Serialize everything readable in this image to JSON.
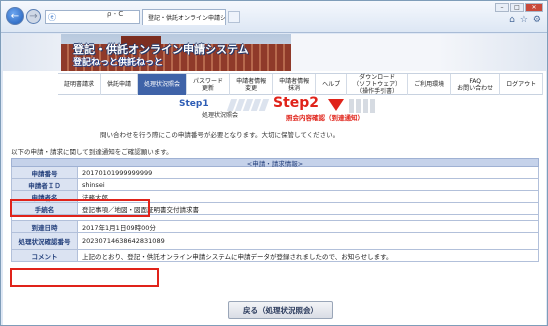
{
  "browser": {
    "address_text": "",
    "tab_title": "登記・供託オンライン申請シス...",
    "addr_controls": "ρ - C"
  },
  "banner": {
    "title": "登記・供託オンライン申請システム",
    "subtitle": "登記ねっと供託ねっと"
  },
  "menu": [
    "証明書請求",
    "供託申請",
    "処理状況照会",
    "パスワード\n更新",
    "申請者情報\n変更",
    "申請者情報\n抹消",
    "ヘルプ",
    "ダウンロード\n（ソフトウェア）\n（操作手引書）",
    "ご利用環境",
    "FAQ\nお問い合わせ",
    "ログアウト"
  ],
  "steps": {
    "step1": "Step1",
    "step1_sub": "処理状況照会",
    "step2": "Step2",
    "step2_sub": "照会内容確認（到達通知）"
  },
  "notice": "問い合わせを行う際にこの申請番号が必要となります。大切に保管してください。",
  "intro": "以下の申請・請求に関して到達通知をご確認願います。",
  "table": {
    "header": "<申請・請求情報>",
    "rows": [
      {
        "label": "申請番号",
        "value": "20170101999999999"
      },
      {
        "label": "申請者ＩＤ",
        "value": "shinsei"
      },
      {
        "label": "申請者名",
        "value": "法務太郎"
      },
      {
        "label": "手続名",
        "value": "登記事項／地図・図面証明書交付請求書"
      },
      {
        "label": "到達日時",
        "value": "2017年1月1日09時00分"
      },
      {
        "label": "処理状況確認番号",
        "value": "20230714638642831089"
      },
      {
        "label": "コメント",
        "value": "上記のとおり、登記・供託オンライン申請システムに申請データが登録されましたので、お知らせします。"
      }
    ]
  },
  "back_button": "戻る（処理状況照会）"
}
